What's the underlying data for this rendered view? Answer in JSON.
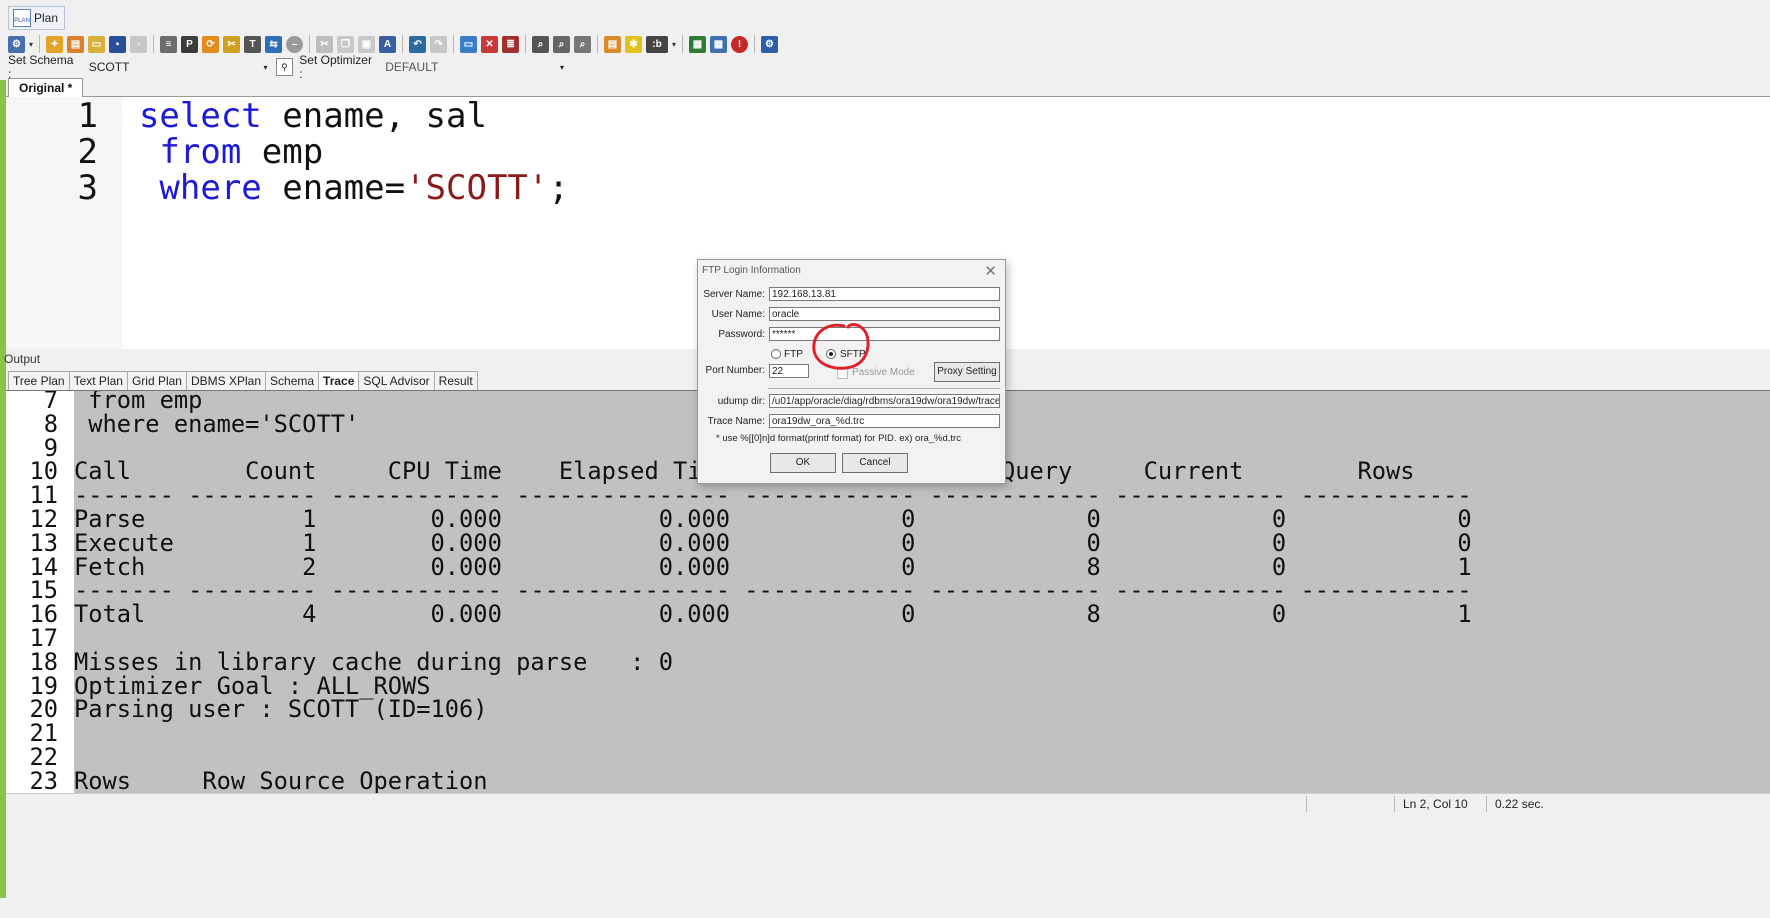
{
  "top": {
    "plan_tab": "Plan"
  },
  "schema_bar": {
    "schema_label": "Set Schema :",
    "schema_value": "SCOTT",
    "optimizer_label": "Set Optimizer :",
    "optimizer_value": "DEFAULT"
  },
  "editor": {
    "tab_label": "Original *",
    "lines": [
      {
        "num": "1",
        "segments": [
          {
            "t": "select",
            "c": "kw"
          },
          {
            "t": " ename, sal",
            "c": "tx"
          }
        ]
      },
      {
        "num": "2",
        "segments": [
          {
            "t": " from",
            "c": "kw"
          },
          {
            "t": " emp",
            "c": "tx"
          }
        ]
      },
      {
        "num": "3",
        "segments": [
          {
            "t": " where",
            "c": "kw"
          },
          {
            "t": " ename=",
            "c": "tx"
          },
          {
            "t": "'SCOTT'",
            "c": "str"
          },
          {
            "t": ";",
            "c": "tx"
          }
        ]
      }
    ]
  },
  "output": {
    "label": "Output",
    "tabs": [
      "Tree Plan",
      "Text Plan",
      "Grid Plan",
      "DBMS XPlan",
      "Schema",
      "Trace",
      "SQL Advisor",
      "Result"
    ],
    "active_tab": "Trace",
    "lines": [
      {
        "num": "7",
        "text": " from emp"
      },
      {
        "num": "8",
        "text": " where ename='SCOTT'"
      },
      {
        "num": "9",
        "text": ""
      },
      {
        "num": "10",
        "text": "Call        Count     CPU Time    Elapsed Time        Disk       Query     Current        Rows"
      },
      {
        "num": "11",
        "text": "------- --------- ------------ --------------- ------------ ------------ ------------ ------------"
      },
      {
        "num": "12",
        "text": "Parse           1        0.000           0.000            0            0            0            0"
      },
      {
        "num": "13",
        "text": "Execute         1        0.000           0.000            0            0            0            0"
      },
      {
        "num": "14",
        "text": "Fetch           2        0.000           0.000            0            8            0            1"
      },
      {
        "num": "15",
        "text": "------- --------- ------------ --------------- ------------ ------------ ------------ ------------"
      },
      {
        "num": "16",
        "text": "Total           4        0.000           0.000            0            8            0            1"
      },
      {
        "num": "17",
        "text": ""
      },
      {
        "num": "18",
        "text": "Misses in library cache during parse   : 0"
      },
      {
        "num": "19",
        "text": "Optimizer Goal : ALL_ROWS"
      },
      {
        "num": "20",
        "text": "Parsing user : SCOTT (ID=106)"
      },
      {
        "num": "21",
        "text": ""
      },
      {
        "num": "22",
        "text": ""
      },
      {
        "num": "23",
        "text": "Rows     Row Source Operation"
      }
    ]
  },
  "status": {
    "position": "Ln 2, Col 10",
    "elapsed": "0.22 sec."
  },
  "dialog": {
    "title": "FTP Login Information",
    "server_name_label": "Server Name:",
    "server_name_value": "192.168.13.81",
    "user_name_label": "User Name:",
    "user_name_value": "oracle",
    "password_label": "Password:",
    "password_value": "******",
    "ftp_label": "FTP",
    "sftp_label": "SFTP",
    "protocol_selected": "SFTP",
    "port_label": "Port Number:",
    "port_value": "22",
    "passive_label": "Passive Mode",
    "proxy_button": "Proxy Setting",
    "udump_label": "udump dir:",
    "udump_value": "/u01/app/oracle/diag/rdbms/ora19dw/ora19dw/trace",
    "trace_label": "Trace Name:",
    "trace_value": "ora19dw_ora_%d.trc",
    "hint": "* use %[[0]n]d format(printf format) for PID.  ex) ora_%d.trc",
    "ok_button": "OK",
    "cancel_button": "Cancel",
    "annotation_color": "#e0202a"
  }
}
